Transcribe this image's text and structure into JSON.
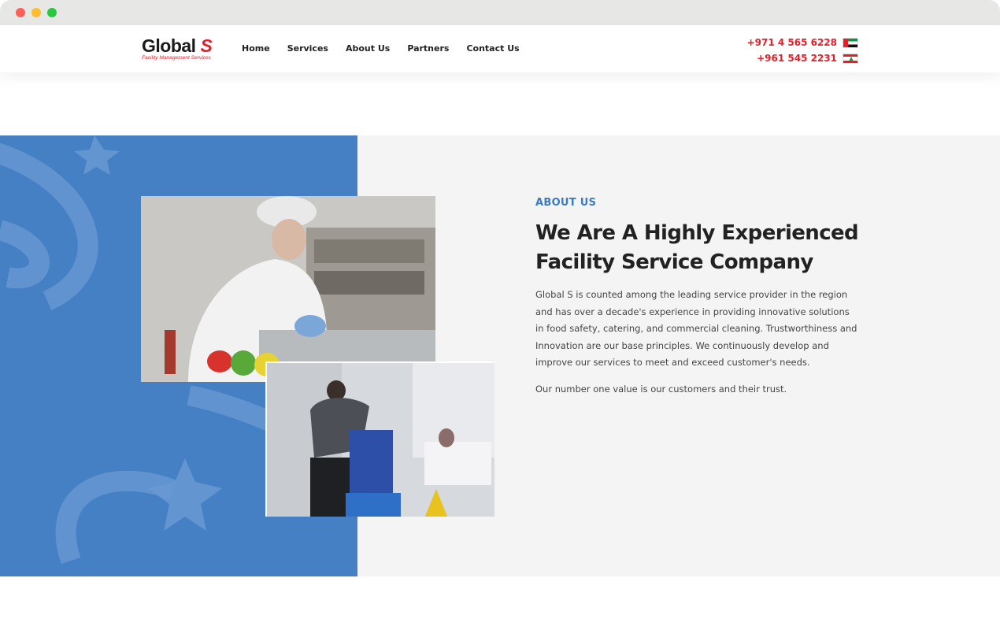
{
  "header": {
    "logo": {
      "brand": "Global",
      "brand_accent": "S",
      "tagline": "Facility Management Services"
    },
    "nav": [
      "Home",
      "Services",
      "About Us",
      "Partners",
      "Contact Us"
    ],
    "phones": [
      {
        "number": "+971 4 565 6228",
        "flag": "uae-flag-icon"
      },
      {
        "number": "+961 545 2231",
        "flag": "lebanon-flag-icon"
      }
    ]
  },
  "about": {
    "eyebrow": "ABOUT US",
    "heading": "We Are A Highly Experienced Facility Service Company",
    "paragraph1": "Global S is counted among the leading service provider in the region and has over a decade's experience in providing innovative solutions in food safety, catering, and commercial cleaning. Trustworthiness and Innovation are our base principles. We continuously develop and  improve our services to meet and exceed customer's needs.",
    "paragraph2": "Our number one value is our customers and their trust."
  },
  "colors": {
    "accent_red": "#e3202a",
    "panel_blue": "#4580c4",
    "eyebrow_blue": "#3a7bc2"
  }
}
